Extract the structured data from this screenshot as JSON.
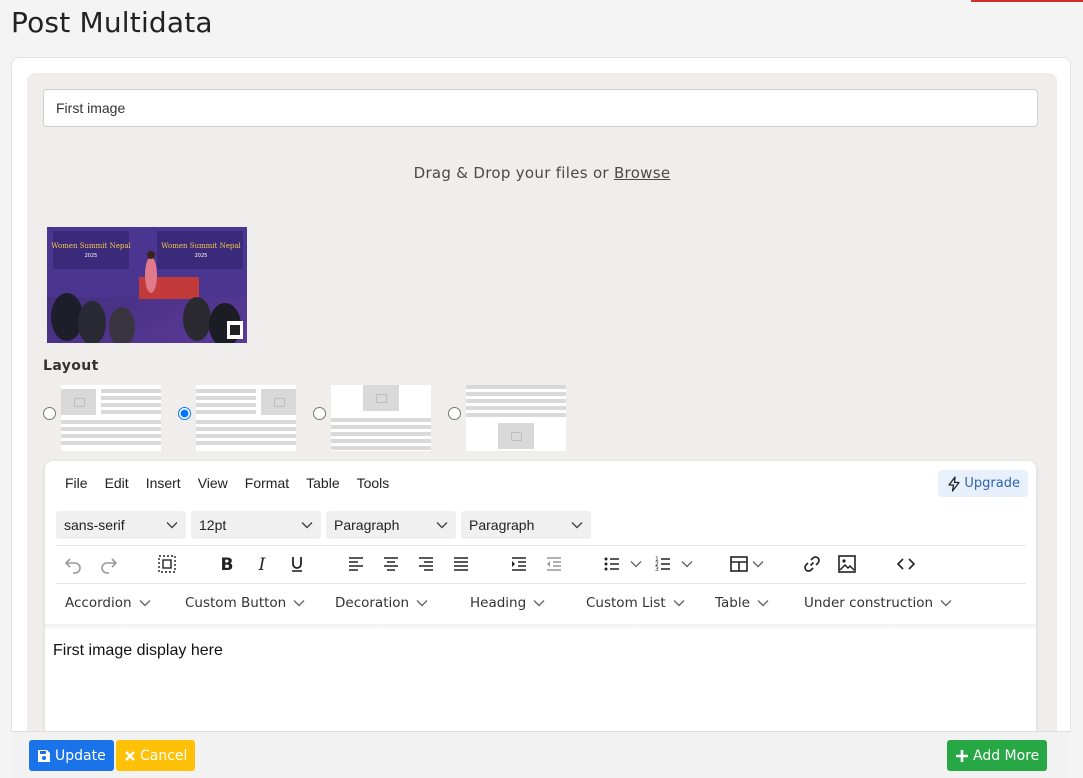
{
  "page": {
    "title": "Post Multidata"
  },
  "form": {
    "title_value": "First image",
    "dropzone": {
      "text": "Drag & Drop your files or ",
      "browse": "Browse"
    },
    "uploaded_image": {
      "banner_left": "Women Summit Nepal",
      "banner_right": "Women Summit Nepal",
      "year": "2025"
    },
    "layout": {
      "label": "Layout",
      "options": [
        {
          "name": "image-left",
          "selected": false
        },
        {
          "name": "image-right",
          "selected": true
        },
        {
          "name": "image-top",
          "selected": false
        },
        {
          "name": "image-bottom",
          "selected": false
        }
      ]
    }
  },
  "editor": {
    "menu": [
      "File",
      "Edit",
      "Insert",
      "View",
      "Format",
      "Table",
      "Tools"
    ],
    "upgrade": "Upgrade",
    "selects": [
      "sans-serif",
      "12pt",
      "Paragraph",
      "Paragraph"
    ],
    "toolbar_icons": [
      "undo-icon",
      "redo-icon",
      "select-all-icon",
      "bold-icon",
      "italic-icon",
      "underline-icon",
      "align-left-icon",
      "align-center-icon",
      "align-right-icon",
      "align-justify-icon",
      "indent-icon",
      "outdent-icon",
      "bullet-list-icon",
      "numbered-list-icon",
      "table-icon",
      "link-icon",
      "image-icon",
      "code-icon"
    ],
    "plugins": [
      "Accordion",
      "Custom Button",
      "Decoration",
      "Heading",
      "Custom List",
      "Table",
      "Under construction"
    ],
    "content": "First image display here"
  },
  "actions": {
    "update": "Update",
    "cancel": "Cancel",
    "add_more": "Add More"
  },
  "colors": {
    "update": "#1a73e8",
    "cancel": "#ffc107",
    "add_more": "#28a745",
    "accent": "#d32f2f"
  }
}
